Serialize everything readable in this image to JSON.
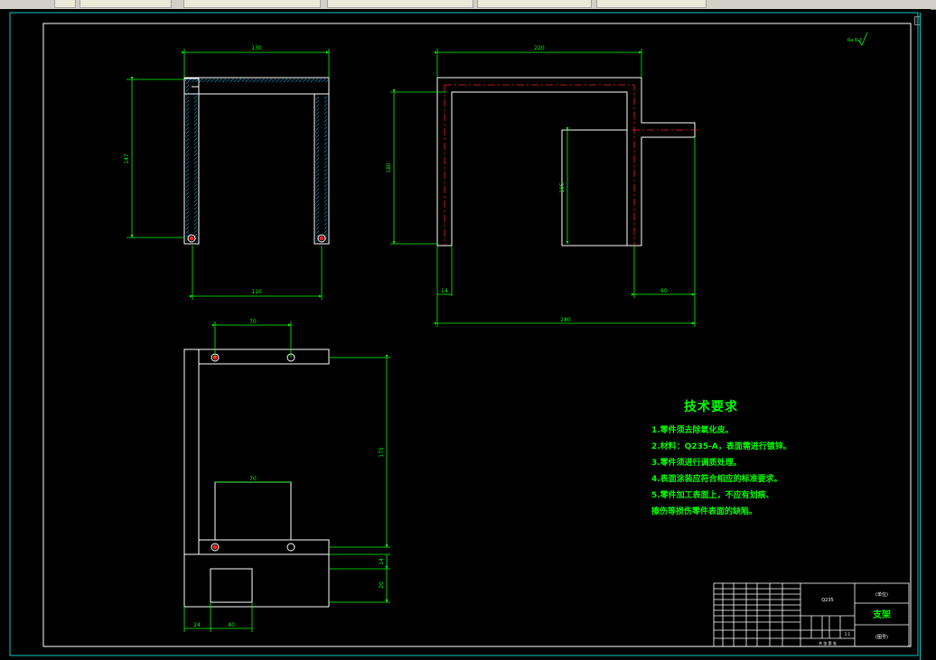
{
  "window": {
    "toolbar_segments": [
      "",
      "",
      "",
      "",
      "",
      ""
    ]
  },
  "drawing": {
    "view_front": {
      "dim_top": "130",
      "dim_left": "147",
      "dim_bottom": "110"
    },
    "view_side": {
      "dim_top": "220",
      "dim_left": "180",
      "dim_mid": "105",
      "dim_bottom_left": "14",
      "dim_bottom_right": "60",
      "dim_overall": "280"
    },
    "view_top": {
      "dim_top": "70",
      "dim_inner": "70",
      "dim_right": "175",
      "dim_r1": "14",
      "dim_r2": "20",
      "dim_b1": "24",
      "dim_b2": "40"
    },
    "roughness": "Ra 6.3"
  },
  "tech_requirements": {
    "title": "技术要求",
    "items": [
      "1.零件须去除氧化皮。",
      "2.材料：Q235-A，表面需进行镀锌。",
      "3.零件须进行调质处理。",
      "4.表面涂装应符合相应的标准要求。",
      "5.零件加工表面上，不应有划痕、",
      "擦伤等损伤零件表面的缺陷。"
    ]
  },
  "title_block": {
    "part_name": "支架",
    "material": "Q235",
    "company": "(单位)",
    "drawing_no": "(图号)",
    "scale": "1:1",
    "footer": "共  张  第  张"
  },
  "colors": {
    "background": "#000000",
    "line": "#ffffff",
    "dimension": "#00ff00",
    "hatch": "#00c0ff",
    "centerline": "#ff0000",
    "frame": "#00c8c8"
  }
}
